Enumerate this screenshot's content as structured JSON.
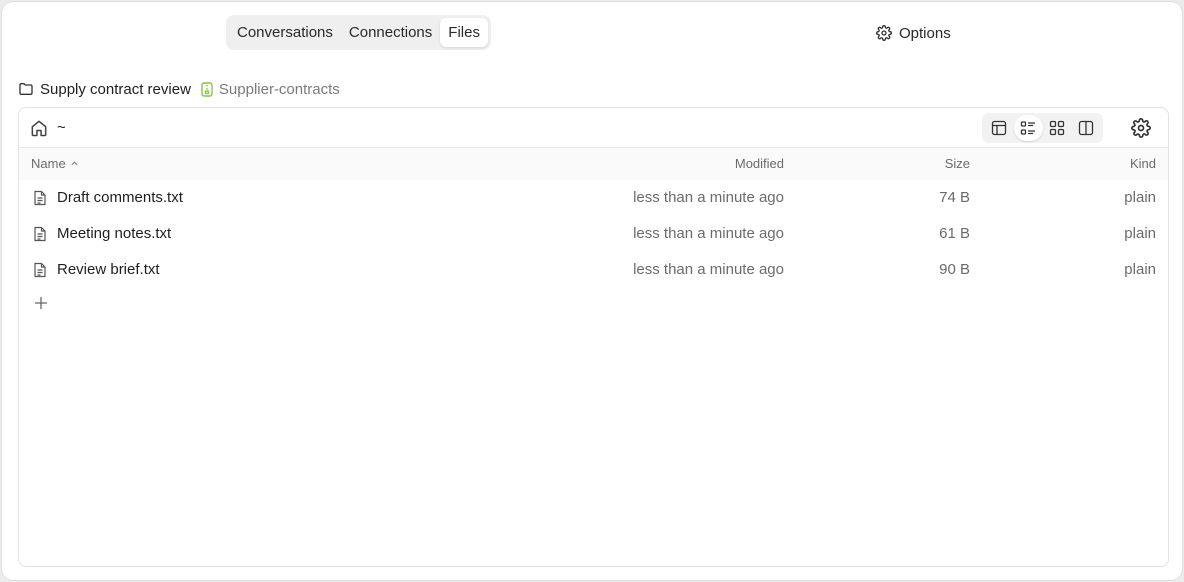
{
  "tabs": [
    {
      "label": "Conversations",
      "active": false
    },
    {
      "label": "Connections",
      "active": false
    },
    {
      "label": "Files",
      "active": true
    }
  ],
  "options_label": "Options",
  "breadcrumb": {
    "project": "Supply contract review",
    "folder": "Supplier-contracts",
    "folder_icon_color": "#8bc34a"
  },
  "toolbar": {
    "path": "~",
    "views": [
      "table-view",
      "list-view",
      "grid-view",
      "split-view"
    ],
    "active_view": "list-view"
  },
  "columns": {
    "name": "Name",
    "modified": "Modified",
    "size": "Size",
    "kind": "Kind",
    "sort": "name-ascending"
  },
  "files": [
    {
      "name": "Draft comments.txt",
      "modified": "less than a minute ago",
      "size": "74 B",
      "kind": "plain"
    },
    {
      "name": "Meeting notes.txt",
      "modified": "less than a minute ago",
      "size": "61 B",
      "kind": "plain"
    },
    {
      "name": "Review brief.txt",
      "modified": "less than a minute ago",
      "size": "90 B",
      "kind": "plain"
    }
  ]
}
